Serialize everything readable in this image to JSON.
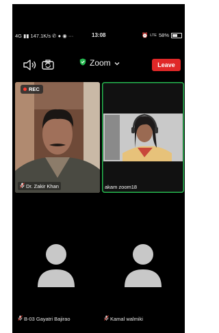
{
  "status_bar": {
    "network": "4G",
    "speed": "147.1K/s",
    "time": "13:08",
    "lte": "LTE",
    "battery": "58%"
  },
  "toolbar": {
    "meeting_title": "Zoom",
    "leave_label": "Leave"
  },
  "video_tiles": [
    {
      "badge": "REC",
      "name": "Dr. Zakir Khan",
      "muted": true
    },
    {
      "name": "akam zoom18",
      "muted": false,
      "active_speaker": true
    }
  ],
  "participants": [
    {
      "name": "B-03 Gayatri Bajirao",
      "muted": true
    },
    {
      "name": "Kamal walmiki",
      "muted": true
    }
  ],
  "colors": {
    "leave": "#e02828",
    "active_speaker_border": "#25b84f",
    "rec_dot": "#ff3b30",
    "shield": "#25b84f"
  }
}
